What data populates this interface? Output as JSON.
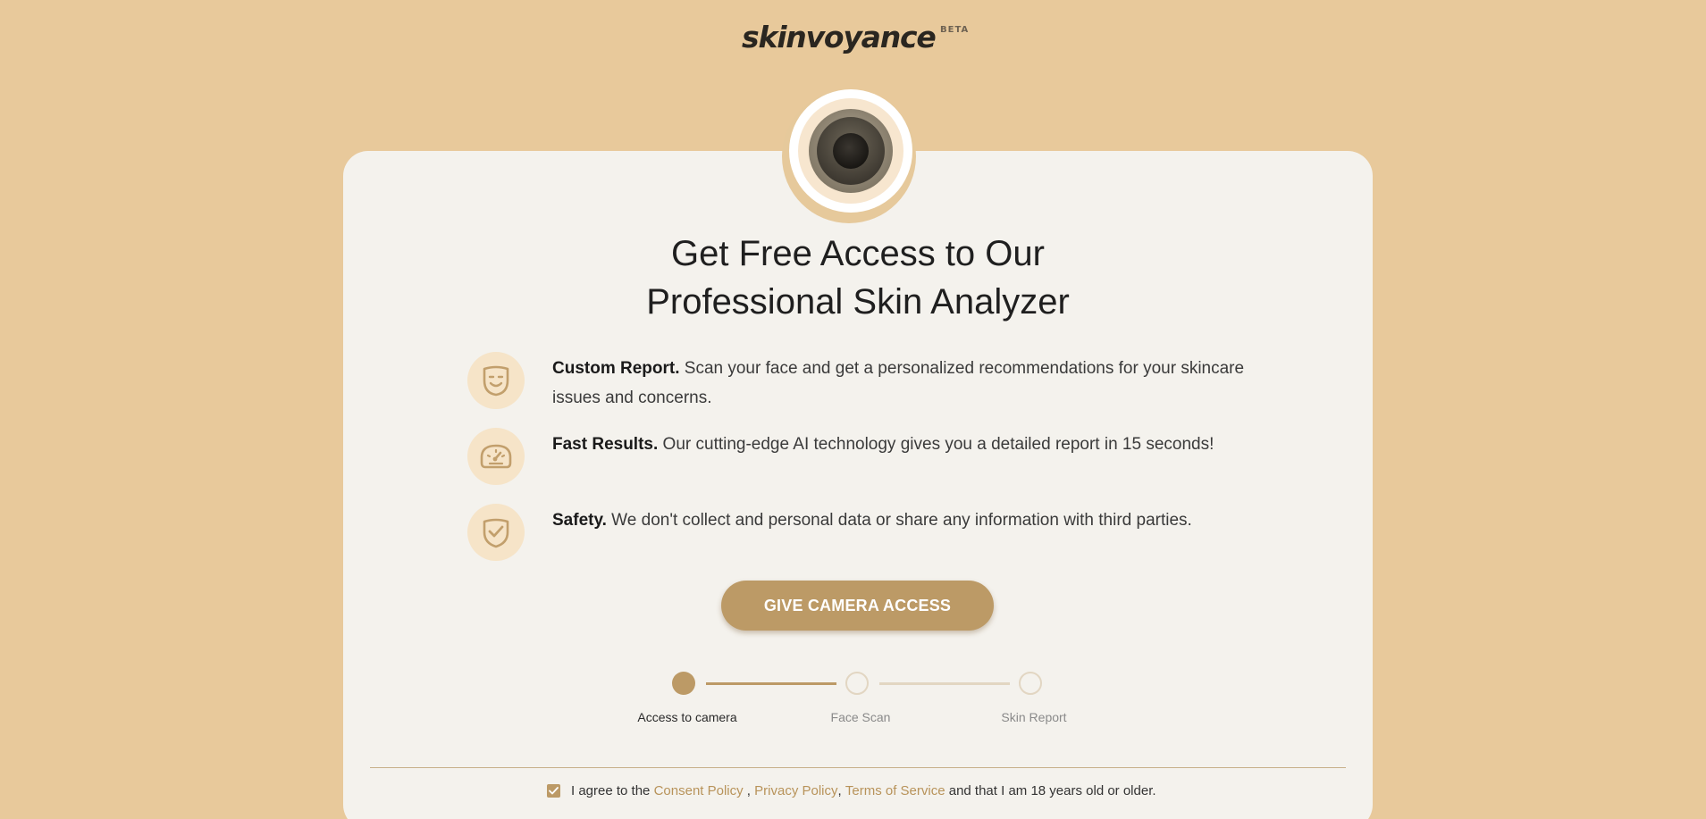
{
  "header": {
    "logo_text": "skinvoyance",
    "beta_label": "BETA"
  },
  "main": {
    "title_line1": "Get Free Access to Our",
    "title_line2": "Professional Skin Analyzer",
    "features": [
      {
        "icon": "smile-face-icon",
        "title": "Custom Report.",
        "text": " Scan your face and get a personalized recommendations for your skincare issues and concerns."
      },
      {
        "icon": "speedometer-icon",
        "title": "Fast Results.",
        "text": " Our cutting-edge AI technology gives you a detailed report in 15 seconds!"
      },
      {
        "icon": "shield-check-icon",
        "title": "Safety.",
        "text": " We don't collect and personal data or share any information with third parties."
      }
    ],
    "cta_label": "GIVE CAMERA ACCESS"
  },
  "steps": [
    {
      "label": "Access to camera",
      "state": "active"
    },
    {
      "label": "Face Scan",
      "state": "inactive"
    },
    {
      "label": "Skin Report",
      "state": "inactive"
    }
  ],
  "consent": {
    "checked": true,
    "prefix": "I agree to the ",
    "consent_link": "Consent Policy",
    "sep1": " , ",
    "privacy_link": "Privacy Policy",
    "sep2": ", ",
    "terms_link": "Terms of Service",
    "suffix": " and that I am 18 years old or older."
  },
  "colors": {
    "background": "#e8c99b",
    "card": "#f4f2ed",
    "accent": "#bc9a66",
    "icon_bg": "#f6e4c8",
    "link": "#b8935a",
    "inactive_step": "#e2d6c2"
  }
}
